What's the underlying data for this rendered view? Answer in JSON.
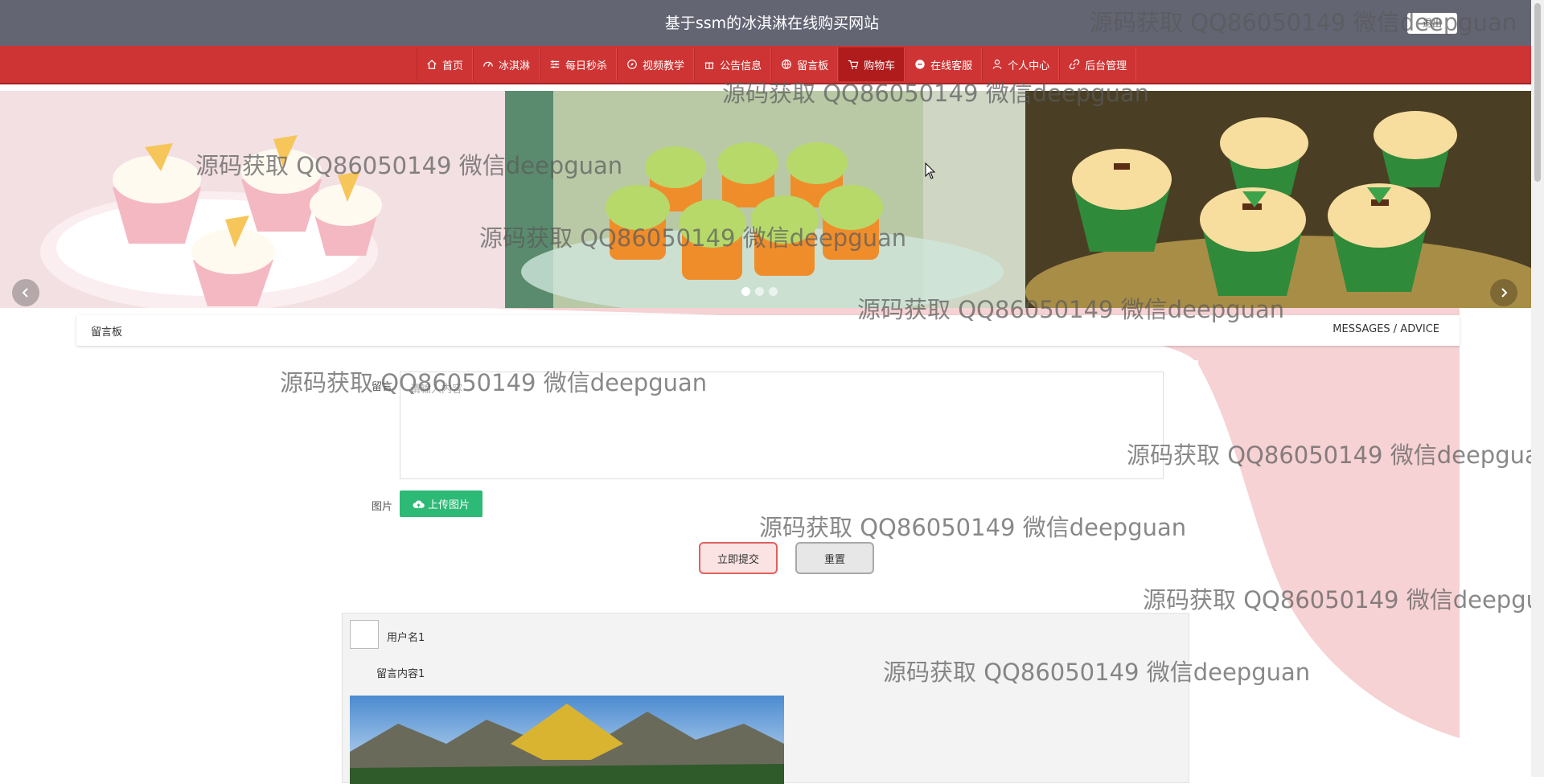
{
  "header": {
    "title": "基于ssm的冰淇淋在线购买网站",
    "logout_label": "退出"
  },
  "nav": {
    "items": [
      {
        "label": "首页",
        "icon": "home-icon"
      },
      {
        "label": "冰淇淋",
        "icon": "dashboard-icon"
      },
      {
        "label": "每日秒杀",
        "icon": "sliders-icon"
      },
      {
        "label": "视频教学",
        "icon": "compass-icon"
      },
      {
        "label": "公告信息",
        "icon": "gift-icon"
      },
      {
        "label": "留言板",
        "icon": "globe-icon"
      },
      {
        "label": "购物车",
        "icon": "cart-icon",
        "active": true
      },
      {
        "label": "在线客服",
        "icon": "chat-icon"
      },
      {
        "label": "个人中心",
        "icon": "user-icon"
      },
      {
        "label": "后台管理",
        "icon": "link-icon"
      }
    ]
  },
  "banner": {
    "slides": [
      "cupcakes-white-frosting",
      "cupcakes-green-frosting",
      "cupcakes-mint-chocolate"
    ],
    "active_dot": 0,
    "dot_count": 3
  },
  "section": {
    "title": "留言板",
    "subtitle": "MESSAGES / ADVICE"
  },
  "form": {
    "message_label": "留言",
    "message_placeholder": "请输入内容",
    "image_label": "图片",
    "upload_label": "上传图片",
    "submit_label": "立即提交",
    "reset_label": "重置"
  },
  "messages": [
    {
      "username": "用户名1",
      "content": "留言内容1"
    }
  ],
  "watermark": "源码获取 QQ86050149 微信deepguan",
  "colors": {
    "topbar": "#636573",
    "nav": "#cf3434",
    "upload": "#2db976",
    "submit_border": "#e06060"
  }
}
